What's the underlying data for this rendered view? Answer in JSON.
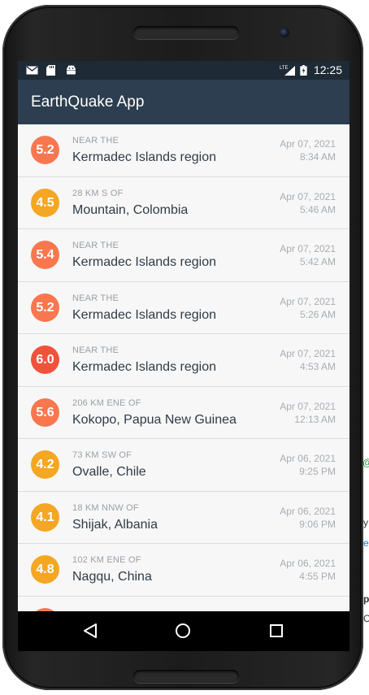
{
  "background_page": {
    "fragments": [
      "@",
      "y",
      "es",
      "p",
      "C"
    ]
  },
  "status_bar": {
    "time": "12:25",
    "left_icons": [
      "gmail-icon",
      "sd-card-icon",
      "android-icon"
    ],
    "right_icons": [
      "lte-signal-icon",
      "battery-charging-icon"
    ],
    "network_label": "LTE"
  },
  "app_bar": {
    "title": "EarthQuake App",
    "color": "#2c3e50"
  },
  "earthquakes": [
    {
      "mag": "5.2",
      "offset": "NEAR THE",
      "place": "Kermadec Islands region",
      "date": "Apr 07, 2021",
      "time": "8:34 AM",
      "color": "#f9774f"
    },
    {
      "mag": "4.5",
      "offset": "28 KM S OF",
      "place": "Mountain, Colombia",
      "date": "Apr 07, 2021",
      "time": "5:46 AM",
      "color": "#f5a623"
    },
    {
      "mag": "5.4",
      "offset": "NEAR THE",
      "place": "Kermadec Islands region",
      "date": "Apr 07, 2021",
      "time": "5:42 AM",
      "color": "#f9774f"
    },
    {
      "mag": "5.2",
      "offset": "NEAR THE",
      "place": "Kermadec Islands region",
      "date": "Apr 07, 2021",
      "time": "5:26 AM",
      "color": "#f9774f"
    },
    {
      "mag": "6.0",
      "offset": "NEAR THE",
      "place": "Kermadec Islands region",
      "date": "Apr 07, 2021",
      "time": "4:53 AM",
      "color": "#f0523b"
    },
    {
      "mag": "5.6",
      "offset": "206 KM ENE OF",
      "place": "Kokopo, Papua New Guinea",
      "date": "Apr 07, 2021",
      "time": "12:13 AM",
      "color": "#f9774f"
    },
    {
      "mag": "4.2",
      "offset": "73 KM SW OF",
      "place": "Ovalle, Chile",
      "date": "Apr 06, 2021",
      "time": "9:25 PM",
      "color": "#f5a623"
    },
    {
      "mag": "4.1",
      "offset": "18 KM NNW OF",
      "place": "Shijak, Albania",
      "date": "Apr 06, 2021",
      "time": "9:06 PM",
      "color": "#f5a623"
    },
    {
      "mag": "4.8",
      "offset": "102 KM ENE OF",
      "place": "Nagqu, China",
      "date": "Apr 06, 2021",
      "time": "4:55 PM",
      "color": "#f5a623"
    },
    {
      "mag": "",
      "offset": "",
      "place": "",
      "date": "",
      "time": "",
      "color": "#f9774f"
    }
  ],
  "nav_bar": {
    "buttons": [
      "back-icon",
      "home-icon",
      "recents-icon"
    ]
  }
}
